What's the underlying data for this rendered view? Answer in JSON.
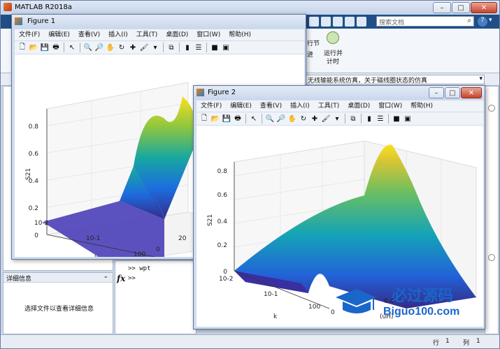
{
  "main": {
    "title": "MATLAB R2018a",
    "search_placeholder": "搜索文档",
    "toolstrip_fragments": [
      "行节",
      "进",
      "运行并",
      "计时"
    ],
    "path_text": "无线输能系统仿真，关于磁线圈状态的仿真",
    "details_title": "详细信息",
    "details_empty": "选择文件以查看详细信息",
    "command_lines": [
      ">> wpt",
      ">>"
    ],
    "fx": "fx",
    "status": {
      "row_label": "行",
      "row": "1",
      "col_label": "列",
      "col": "1"
    }
  },
  "menus": [
    "文件(F)",
    "编辑(E)",
    "查看(V)",
    "插入(I)",
    "工具(T)",
    "桌面(D)",
    "窗口(W)",
    "帮助(H)"
  ],
  "figure1": {
    "title": "Figure 1",
    "zlabel": "S21",
    "xlabel": "k",
    "z_ticks": [
      "0",
      "0.2",
      "0.4",
      "0.6",
      "0.8"
    ],
    "x_ticks": [
      "10-2",
      "10-1",
      "100"
    ],
    "y_ticks": [
      "0",
      "20"
    ]
  },
  "figure2": {
    "title": "Figure 2",
    "zlabel": "S21",
    "xlabel": "k",
    "ylabel": "(uH)",
    "z_ticks": [
      "0",
      "0.2",
      "0.4",
      "0.6",
      "0.8"
    ],
    "x_ticks": [
      "10-2",
      "10-1",
      "100"
    ],
    "y_ticks": [
      "0",
      "0.4"
    ]
  },
  "watermark": {
    "cn": "必过源码",
    "en": "Biguo100.com"
  }
}
